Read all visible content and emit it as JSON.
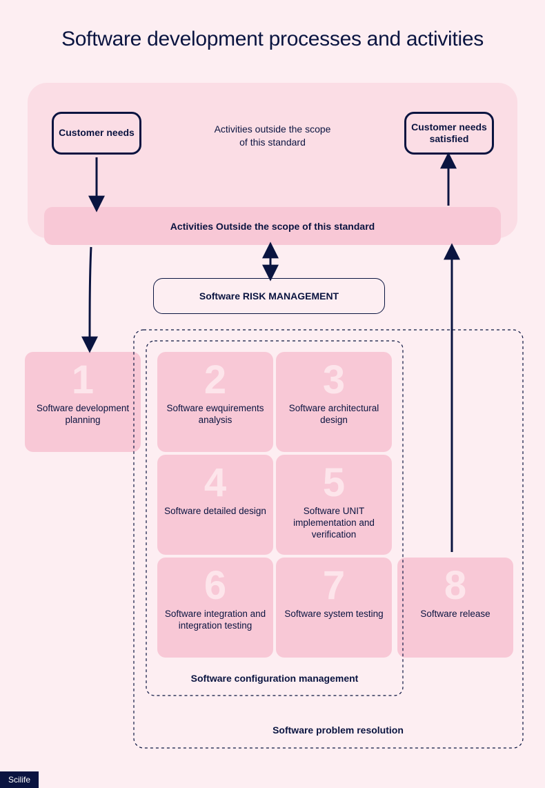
{
  "title": "Software development processes and activities",
  "scope_text_line1": "Activities outside the scope",
  "scope_text_line2": "of this standard",
  "customer_left": "Customer needs",
  "customer_right": "Customer needs satisfied",
  "band_label": "Activities Outside the scope of this standard",
  "risk_label": "Software RISK MANAGEMENT",
  "steps": [
    {
      "n": "1",
      "label": "Software development planning"
    },
    {
      "n": "2",
      "label": "Software ewquirements analysis"
    },
    {
      "n": "3",
      "label": "Software architectural design"
    },
    {
      "n": "4",
      "label": "Software detailed design"
    },
    {
      "n": "5",
      "label": "Software UNIT implementation and verification"
    },
    {
      "n": "6",
      "label": "Software integration and integration testing"
    },
    {
      "n": "7",
      "label": "Software system testing"
    },
    {
      "n": "8",
      "label": "Software release"
    }
  ],
  "caption_config": "Software configuration management",
  "caption_problem": "Software problem resolution",
  "footer": "Scilife"
}
